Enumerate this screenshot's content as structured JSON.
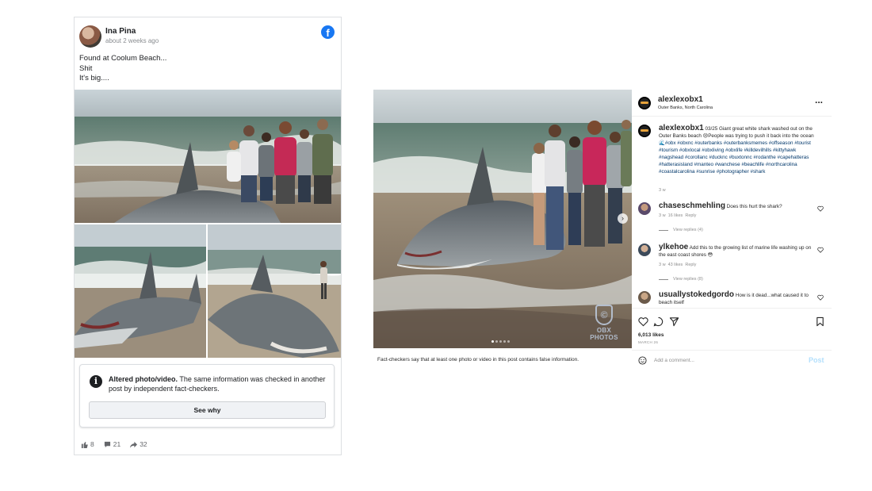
{
  "facebook_post": {
    "author": "Ina Pina",
    "time": "about 2 weeks ago",
    "text_lines": [
      "Found at Coolum Beach...",
      "Shit",
      "It's big...."
    ],
    "brand_icon": "facebook-logo-icon",
    "brand_letter": "f",
    "fact_check": {
      "title": "Altered photo/video.",
      "body": " The same information was checked in another post by independent fact-checkers.",
      "button": "See why"
    },
    "stats": {
      "likes": "8",
      "comments": "21",
      "shares": "32"
    }
  },
  "instagram_post": {
    "username": "alexlexobx1",
    "location": "Outer Banks, North Carolina",
    "more": "...",
    "fact_check_notice": "Fact-checkers say that at least one photo or video in this post contains false information.",
    "watermark": "OBX PHOTOS",
    "watermark_symbol": "©",
    "caption": {
      "user": "alexlexobx1",
      "text": " 03/25 Giant great white shark washed out on the Outer Banks beach 😢People was trying to push it back into the ocean 🌊",
      "tags": "#obx #obxnc #outerbanks #outerbanksmemes #offseason #tourist #tourism #obxlocal #obxliving #obxlife #killdevilhills #kittyhawk #nagshead #corollanc #ducknc #buxtonnc #rodanthe #capehatteras #hatterasisland #manteo #wanchese #beachlife #northcarolina #coastalcarolina #sunrise #photographer #shark",
      "age": "3 w"
    },
    "comments": [
      {
        "user": "chaseschmehling",
        "text": " Does this hurt the shark?",
        "age": "3 w",
        "likes": "16 likes",
        "reply": "Reply",
        "view_replies": "View replies (4)"
      },
      {
        "user": "ylkehoe",
        "text": " Add this to the growing list of marine life washing up on the east coast shores 😳",
        "age": "3 w",
        "likes": "43 likes",
        "reply": "Reply",
        "view_replies": "View replies (8)"
      },
      {
        "user": "usuallystokedgordo",
        "text": " How is it dead...what caused it to beach itself"
      }
    ],
    "likes": "6,013 likes",
    "date": "MARCH 26",
    "add_comment_placeholder": "Add a comment...",
    "post_button": "Post"
  },
  "colors": {
    "facebook_blue": "#1877f2",
    "instagram_link": "#00376b",
    "post_disabled": "#b2dffc"
  }
}
